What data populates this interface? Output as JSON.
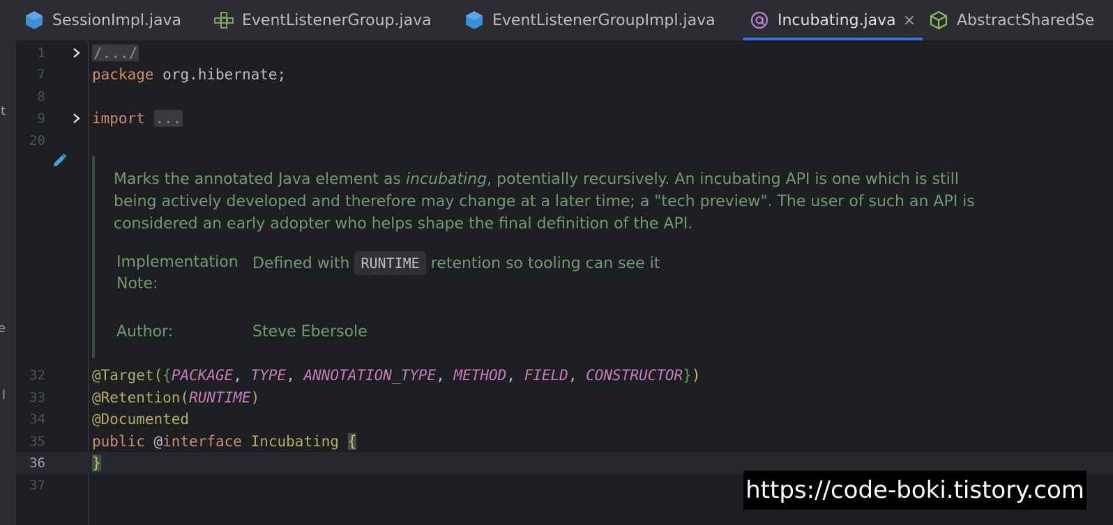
{
  "tabs": [
    {
      "label": "SessionImpl.java",
      "icon": "class-icon",
      "active": false
    },
    {
      "label": "EventListenerGroup.java",
      "icon": "interface-icon",
      "active": false
    },
    {
      "label": "EventListenerGroupImpl.java",
      "icon": "class-icon",
      "active": false
    },
    {
      "label": "Incubating.java",
      "icon": "annotation-icon",
      "active": true
    },
    {
      "label": "AbstractSharedSe",
      "icon": "abstract-class-icon",
      "active": false
    }
  ],
  "tab_close_glyph": "×",
  "left_strip_glyphs": [
    "t",
    "e",
    "l"
  ],
  "lines": {
    "n1": "1",
    "n7": "7",
    "n8": "8",
    "n9": "9",
    "n20": "20",
    "n32": "32",
    "n33": "33",
    "n34": "34",
    "n35": "35",
    "n36": "36",
    "n37": "37"
  },
  "code": {
    "header_fold": "/.../",
    "package_kw": "package",
    "package_name": " org.hibernate;",
    "import_kw": "import",
    "import_fold": "...",
    "target_ann": "@Target(",
    "brace_open": "{",
    "c_package": "PACKAGE",
    "c_type": "TYPE",
    "c_annotation_type": "ANNOTATION_TYPE",
    "c_method": "METHOD",
    "c_field": "FIELD",
    "c_constructor": "CONSTRUCTOR",
    "comma": ", ",
    "brace_close": "}",
    "paren_close": ")",
    "retention_ann": "@Retention(",
    "c_runtime": "RUNTIME",
    "documented_ann": "@Documented",
    "public_kw": "public",
    "at": " @",
    "interface_kw": "interface",
    "class_name": " Incubating ",
    "open_brace": "{",
    "close_brace": "}"
  },
  "doc": {
    "p1_before": "Marks the annotated Java element as ",
    "p1_em": "incubating",
    "p1_after": ", potentially recursively. An incubating API is one which is still being actively developed and therefore may change at a later time; a \"tech preview\". The user of such an API is considered an early adopter who helps shape the final definition of the API.",
    "impl_label_1": "Implementation",
    "impl_label_2": "Note:",
    "impl_before": "Defined with ",
    "impl_chip": "RUNTIME",
    "impl_after": " retention so tooling can see it",
    "author_label": "Author:",
    "author_value": "Steve Ebersole"
  },
  "watermark": "https://code-boki.tistory.com",
  "colors": {
    "accent": "#3574f0",
    "keyword": "#cf8e6d",
    "annotation": "#b3ae60",
    "constant": "#c77dbb",
    "doc_text": "#6f9a73"
  }
}
